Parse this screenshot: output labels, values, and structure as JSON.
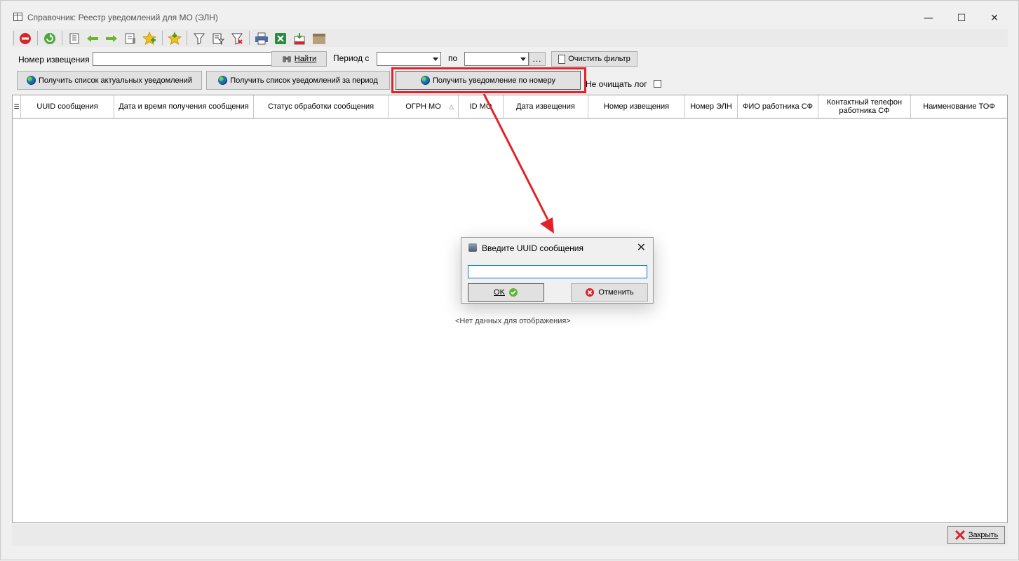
{
  "window": {
    "title": "Справочник: Реестр уведомлений для МО (ЭЛН)",
    "minimize": "—",
    "maximize": "☐",
    "close": "✕"
  },
  "toolbar": {
    "icons": [
      "stop-icon",
      "refresh-icon",
      "card-icon",
      "arrow-left-icon",
      "arrow-right-icon",
      "card-edit-icon",
      "add-icon",
      "favorite-icon",
      "filter-icon",
      "filter-edit-icon",
      "filter-clear-icon",
      "print-icon",
      "excel-icon",
      "export-icon",
      "archive-icon"
    ]
  },
  "filter": {
    "notice_number_label": "Номер извещения",
    "notice_number_value": "",
    "find_label": "Найти",
    "period_from_label": "Период с",
    "period_from_value": "",
    "period_to_label": "по",
    "period_to_value": "",
    "dots_label": "...",
    "clear_filter_label": "Очистить фильтр"
  },
  "actions": {
    "get_actual": "Получить список актуальных уведомлений",
    "get_period": "Получить список уведомлений за период",
    "get_by_number": "Получить уведомление по номеру",
    "keep_log_label": "Не очищать лог"
  },
  "grid": {
    "columns": [
      "UUID сообщения",
      "Дата и время получения сообщения",
      "Статус обработки сообщения",
      "ОГРН МО",
      "ID МО",
      "Дата извещения",
      "Номер извещения",
      "Номер ЭЛН",
      "ФИО работника СФ",
      "Контактный телефон работника СФ",
      "Наименование ТОФ"
    ],
    "sort_indicator": "△",
    "empty_text": "<Нет данных для отображения>"
  },
  "footer": {
    "close_label": "Закрыть"
  },
  "dialog": {
    "title": "Введите UUID сообщения",
    "input_value": "",
    "ok_label": "OK",
    "cancel_label": "Отменить"
  },
  "colors": {
    "highlight": "#e32129",
    "accent": "#0078d7"
  }
}
